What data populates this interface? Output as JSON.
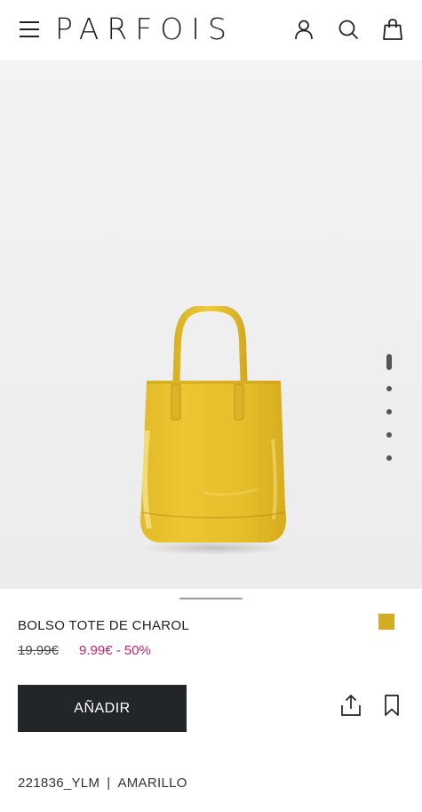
{
  "header": {
    "logo": "PARFOIS",
    "icons": [
      "menu-icon",
      "user-icon",
      "search-icon",
      "shopping-bag-icon"
    ]
  },
  "gallery": {
    "image_alt": "Bolso tote de charol amarillo",
    "slides": 5,
    "active_slide": 1
  },
  "product": {
    "name": "BOLSO TOTE DE CHAROL",
    "old_price": "19.99€",
    "sale_price": "9.99€ - 50%",
    "swatch_color": "#d4ad22",
    "sale_color": "#c2236f",
    "add_button": "AÑADIR",
    "reference": "221836_YLM",
    "separator": "|",
    "color_name": "AMARILLO"
  },
  "actions": {
    "icons": [
      "share-icon",
      "bookmark-icon"
    ]
  }
}
